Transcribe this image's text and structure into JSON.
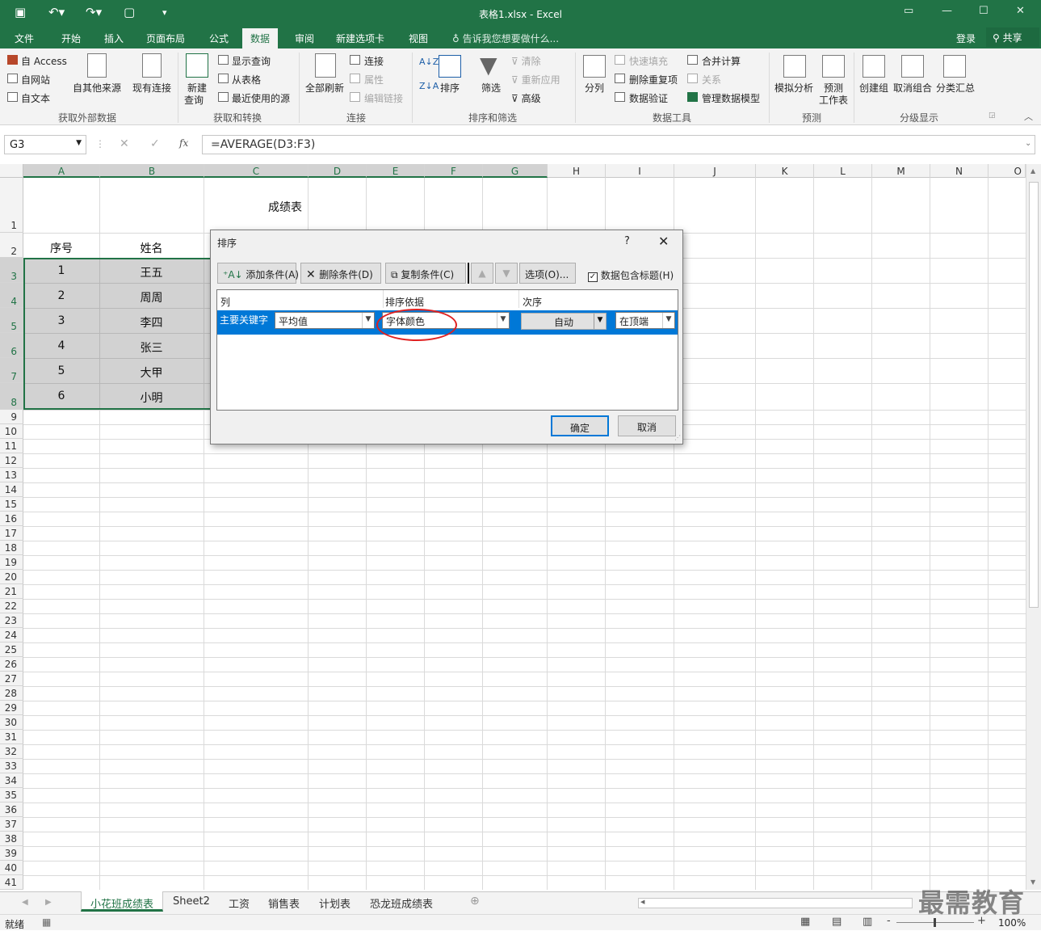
{
  "window": {
    "title": "表格1.xlsx - Excel"
  },
  "tabs": [
    "文件",
    "开始",
    "插入",
    "页面布局",
    "公式",
    "数据",
    "审阅",
    "新建选项卡",
    "视图"
  ],
  "active_tab": "数据",
  "tellme": "告诉我您想要做什么...",
  "account": {
    "login": "登录",
    "share": "共享"
  },
  "ribbon": {
    "ext": {
      "access": "Access",
      "web": "自网站",
      "text": "自文本",
      "other": "自其他来源",
      "existing": "现有连接",
      "group": "获取外部数据"
    },
    "transform": {
      "new_query_1": "新建",
      "new_query_2": "查询",
      "show_queries": "显示查询",
      "from_table": "从表格",
      "recent": "最近使用的源",
      "group": "获取和转换"
    },
    "conn": {
      "refresh": "全部刷新",
      "connections": "连接",
      "properties": "属性",
      "edit_links": "编辑链接",
      "group": "连接"
    },
    "sortfilter": {
      "sort": "排序",
      "filter": "筛选",
      "clear": "清除",
      "reapply": "重新应用",
      "advanced": "高级",
      "group": "排序和筛选"
    },
    "tools": {
      "split": "分列",
      "flash": "快速填充",
      "remove_dup": "删除重复项",
      "validate": "数据验证",
      "consolidate": "合并计算",
      "relations": "关系",
      "model": "管理数据模型",
      "group": "数据工具"
    },
    "forecast": {
      "whatif": "模拟分析",
      "sheet_1": "预测",
      "sheet_2": "工作表",
      "group": "预测"
    },
    "outline": {
      "group_btn": "创建组",
      "ungroup": "取消组合",
      "subtotal": "分类汇总",
      "group": "分级显示"
    }
  },
  "formula_bar": {
    "name_box": "G3",
    "formula": "=AVERAGE(D3:F3)",
    "fx": "fx"
  },
  "columns": [
    "A",
    "B",
    "C",
    "D",
    "E",
    "F",
    "G",
    "H",
    "I",
    "J",
    "K",
    "L",
    "M",
    "N",
    "O"
  ],
  "rows": [
    "1",
    "2",
    "3",
    "4",
    "5",
    "6",
    "7",
    "8",
    "9",
    "10",
    "11",
    "12",
    "13",
    "14",
    "15",
    "16",
    "17",
    "18",
    "19",
    "20",
    "21",
    "22",
    "23",
    "24",
    "25",
    "26",
    "27",
    "28",
    "29",
    "30",
    "31",
    "32",
    "33",
    "34",
    "35",
    "36",
    "37",
    "38",
    "39",
    "40",
    "41"
  ],
  "sheet": {
    "title": "成绩表",
    "headers": [
      "序号",
      "姓名"
    ],
    "records": [
      [
        "1",
        "王五"
      ],
      [
        "2",
        "周周"
      ],
      [
        "3",
        "李四"
      ],
      [
        "4",
        "张三"
      ],
      [
        "5",
        "大甲"
      ],
      [
        "6",
        "小明"
      ]
    ]
  },
  "dialog": {
    "title": "排序",
    "help": "?",
    "add": "添加条件(A)",
    "del": "删除条件(D)",
    "copy": "复制条件(C)",
    "options": "选项(O)...",
    "has_header": "数据包含标题(H)",
    "has_header_checked": true,
    "col_header": "列",
    "basis_header": "排序依据",
    "order_header": "次序",
    "row_label": "主要关键字",
    "column_value": "平均值",
    "basis_value": "字体颜色",
    "color_value": "自动",
    "position_value": "在顶端",
    "ok": "确定",
    "cancel": "取消"
  },
  "sheet_tabs": [
    "小花班成绩表",
    "Sheet2",
    "工资",
    "销售表",
    "计划表",
    "恐龙班成绩表"
  ],
  "active_sheet": "小花班成绩表",
  "status": {
    "ready": "就绪",
    "zoom": "100%"
  },
  "watermark": "最需教育",
  "colors": {
    "accent": "#217346",
    "selection": "#d2d2d2",
    "annotation": "#e02020"
  }
}
